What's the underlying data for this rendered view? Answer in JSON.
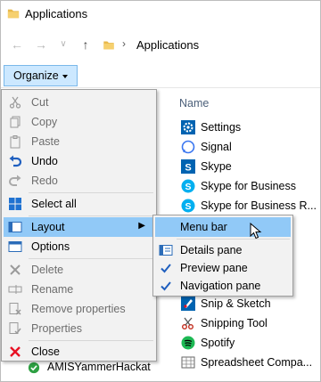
{
  "window": {
    "title": "Applications"
  },
  "address": {
    "crumb": "Applications"
  },
  "toolbar": {
    "organize_label": "Organize"
  },
  "list": {
    "header": "Name",
    "items": [
      {
        "name": "Settings",
        "icon": "gear-icon"
      },
      {
        "name": "Signal",
        "icon": "signal-icon"
      },
      {
        "name": "Skype",
        "icon": "skype-icon"
      },
      {
        "name": "Skype for Business",
        "icon": "skype-business-icon"
      },
      {
        "name": "Skype for Business R...",
        "icon": "skype-business-icon"
      },
      {
        "name": "Snip & Sketch",
        "icon": "snip-sketch-icon"
      },
      {
        "name": "Snipping Tool",
        "icon": "scissors-icon"
      },
      {
        "name": "Spotify",
        "icon": "spotify-icon"
      },
      {
        "name": "Spreadsheet Compa...",
        "icon": "spreadsheet-icon"
      }
    ],
    "side_item": "AMISYammerHackat"
  },
  "menu": {
    "cut": "Cut",
    "copy": "Copy",
    "paste": "Paste",
    "undo": "Undo",
    "redo": "Redo",
    "select_all": "Select all",
    "layout": "Layout",
    "options": "Options",
    "delete": "Delete",
    "rename": "Rename",
    "remove_properties": "Remove properties",
    "properties": "Properties",
    "close": "Close"
  },
  "submenu": {
    "menu_bar": "Menu bar",
    "details_pane": "Details pane",
    "preview_pane": "Preview pane",
    "navigation_pane": "Navigation pane"
  },
  "colors": {
    "highlight": "#91c9f7",
    "menu_bg": "#f2f2f2",
    "organize_bg": "#cce8ff",
    "skype_blue": "#00aff0",
    "spotify_green": "#1db954",
    "close_red": "#e81123"
  }
}
